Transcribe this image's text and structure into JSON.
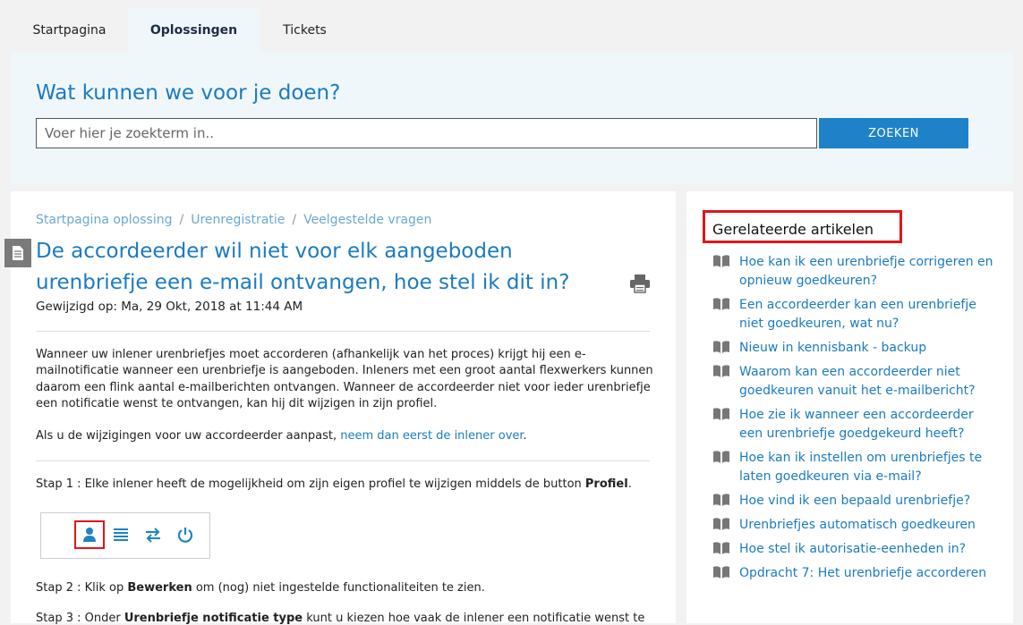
{
  "nav": {
    "tabs": [
      {
        "label": "Startpagina",
        "active": false
      },
      {
        "label": "Oplossingen",
        "active": true
      },
      {
        "label": "Tickets",
        "active": false
      }
    ]
  },
  "hero": {
    "title": "Wat kunnen we voor je doen?",
    "search_placeholder": "Voer hier je zoekterm in..",
    "search_button": "ZOEKEN"
  },
  "breadcrumb": [
    "Startpagina oplossing",
    "Urenregistratie",
    "Veelgestelde vragen"
  ],
  "article": {
    "title": "De accordeerder wil niet voor elk aangeboden urenbriefje een e-mail ontvangen, hoe stel ik dit in?",
    "modified": "Gewijzigd op: Ma, 29 Okt, 2018 at 11:44 AM",
    "paragraph1": "Wanneer uw inlener urenbriefjes moet accorderen (afhankelijk van het proces) krijgt hij een e-mailnotificatie wanneer een urenbriefje is aangeboden. Inleners met een groot aantal flexwerkers kunnen daarom een flink aantal e-mailberichten ontvangen. Wanneer de accordeerder niet voor ieder urenbriefje een notificatie wenst te ontvangen, kan hij dit wijzigen in zijn profiel.",
    "paragraph2_prefix": "Als u de wijzigingen voor uw accordeerder aanpast, ",
    "paragraph2_link": "neem dan eerst de inlener over",
    "paragraph2_suffix": ".",
    "step1_prefix": "Stap 1 : Elke inlener heeft de mogelijkheid om zijn eigen profiel te wijzigen middels de button ",
    "step1_bold": "Profiel",
    "step1_suffix": ".",
    "step2_prefix": "Stap 2 : Klik op ",
    "step2_bold": "Bewerken",
    "step2_suffix": " om (nog) niet ingestelde functionaliteiten te zien.",
    "step3_prefix": "Stap 3 : Onder ",
    "step3_bold": "Urenbriefje notificatie type",
    "step3_suffix": " kunt u kiezen hoe vaak de inlener een notificatie wenst te"
  },
  "toolbar_icons": [
    "user-icon",
    "list-icon",
    "swap-icon",
    "power-icon"
  ],
  "related": {
    "title": "Gerelateerde artikelen",
    "items": [
      "Hoe kan ik een urenbriefje corrigeren en opnieuw goedkeuren?",
      "Een accordeerder kan een urenbriefje niet goedkeuren, wat nu?",
      "Nieuw in kennisbank - backup",
      "Waarom kan een accordeerder niet goedkeuren vanuit het e-mailbericht?",
      "Hoe zie ik wanneer een accordeerder een urenbriefje goedgekeurd heeft?",
      "Hoe kan ik instellen om urenbriefjes te laten goedkeuren via e-mail?",
      "Hoe vind ik een bepaald urenbriefje?",
      "Urenbriefjes automatisch goedkeuren",
      "Hoe stel ik autorisatie-eenheden in?",
      "Opdracht 7: Het urenbriefje accorderen"
    ]
  },
  "colors": {
    "accent": "#1b7bbf",
    "button": "#1f82c8",
    "highlight": "#e0161c"
  }
}
